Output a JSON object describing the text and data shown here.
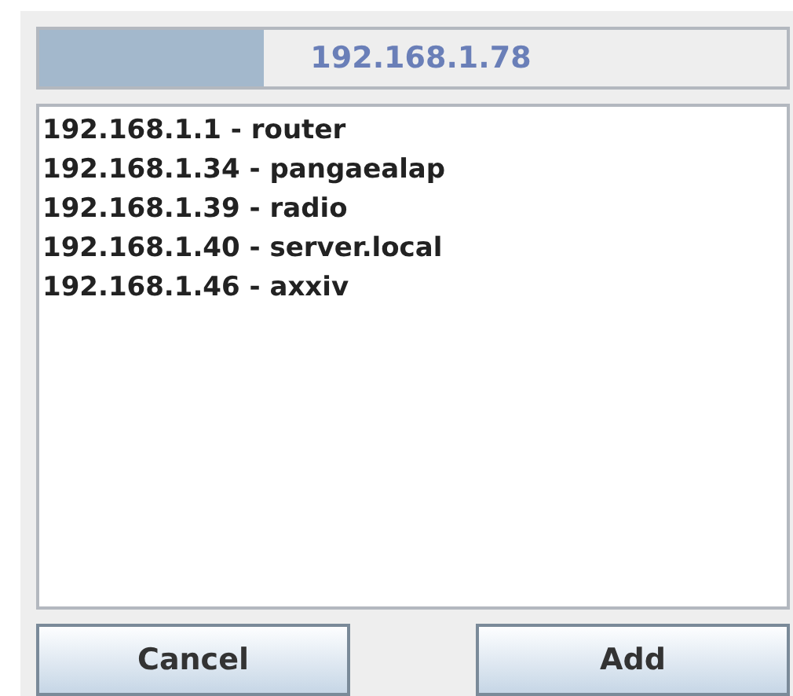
{
  "progress": {
    "text": "192.168.1.78",
    "level": 0.3
  },
  "hosts": [
    {
      "label": "192.168.1.1 - router"
    },
    {
      "label": "192.168.1.34 - pangaealap"
    },
    {
      "label": "192.168.1.39 - radio"
    },
    {
      "label": "192.168.1.40 - server.local"
    },
    {
      "label": "192.168.1.46 - axxiv"
    }
  ],
  "buttons": [
    {
      "label": "Cancel"
    },
    {
      "label": "Add"
    }
  ]
}
